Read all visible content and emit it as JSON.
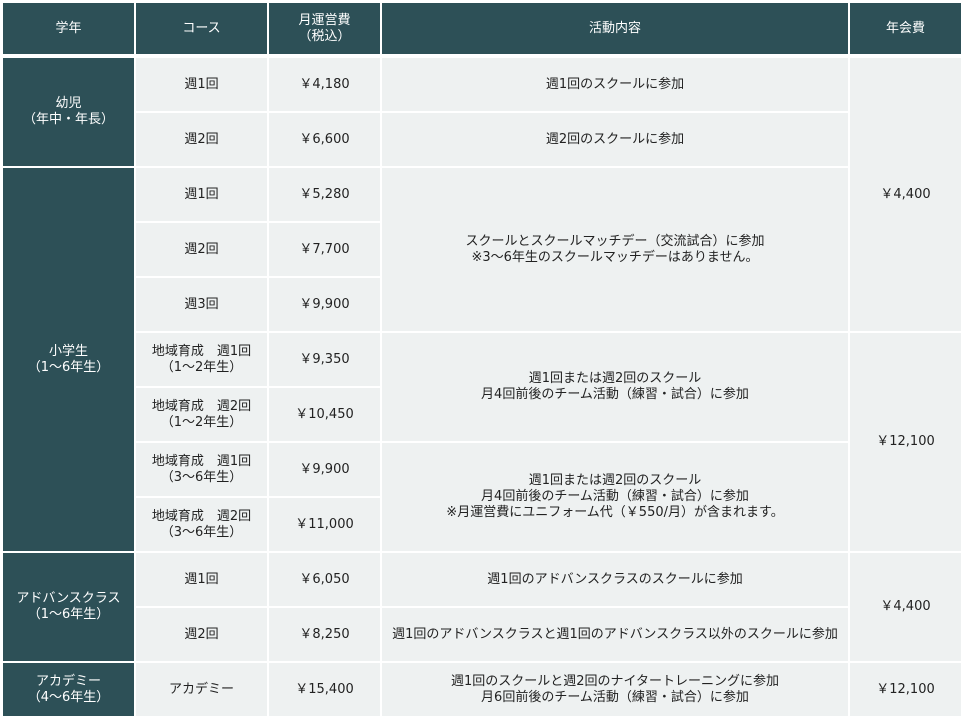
{
  "colors": {
    "header_bg": "#2d5057",
    "cell_bg": "#eef1f1",
    "header_text": "#ffffff",
    "cell_text": "#222222"
  },
  "header": {
    "grade": "学年",
    "course": "コース",
    "monthly_fee": [
      "月運営費",
      "（税込）"
    ],
    "activity": "活動内容",
    "annual_fee": "年会費"
  },
  "groups": {
    "infant": [
      "幼児",
      "（年中・年長）"
    ],
    "elementary": [
      "小学生",
      "（1～6年生）"
    ],
    "advanced": [
      "アドバンスクラス",
      "（1～6年生）"
    ],
    "academy": [
      "アカデミー",
      "（4～6年生）"
    ]
  },
  "rows": [
    {
      "course": [
        "週1回"
      ],
      "fee": "￥4,180"
    },
    {
      "course": [
        "週2回"
      ],
      "fee": "￥6,600"
    },
    {
      "course": [
        "週1回"
      ],
      "fee": "￥5,280"
    },
    {
      "course": [
        "週2回"
      ],
      "fee": "￥7,700"
    },
    {
      "course": [
        "週3回"
      ],
      "fee": "￥9,900"
    },
    {
      "course": [
        "地域育成　週1回",
        "（1～2年生）"
      ],
      "fee": "￥9,350"
    },
    {
      "course": [
        "地域育成　週2回",
        "（1～2年生）"
      ],
      "fee": "￥10,450"
    },
    {
      "course": [
        "地域育成　週1回",
        "（3～6年生）"
      ],
      "fee": "￥9,900"
    },
    {
      "course": [
        "地域育成　週2回",
        "（3～6年生）"
      ],
      "fee": "￥11,000"
    },
    {
      "course": [
        "週1回"
      ],
      "fee": "￥6,050"
    },
    {
      "course": [
        "週2回"
      ],
      "fee": "￥8,250"
    },
    {
      "course": [
        "アカデミー"
      ],
      "fee": "￥15,400"
    }
  ],
  "activities": [
    [
      "週1回のスクールに参加"
    ],
    [
      "週2回のスクールに参加"
    ],
    [
      "スクールとスクールマッチデー（交流試合）に参加",
      "※3～6年生のスクールマッチデーはありません。"
    ],
    [
      "週1回または週2回のスクール",
      "月4回前後のチーム活動（練習・試合）に参加"
    ],
    [
      "週1回または週2回のスクール",
      "月4回前後のチーム活動（練習・試合）に参加",
      "※月運営費にユニフォーム代（￥550/月）が含まれます。"
    ],
    [
      "週1回のアドバンスクラスのスクールに参加"
    ],
    [
      "週1回のアドバンスクラスと週1回のアドバンスクラス以外のスクールに参加"
    ],
    [
      "週1回のスクールと週2回のナイタートレーニングに参加",
      "月6回前後のチーム活動（練習・試合）に参加"
    ]
  ],
  "annual_fees": [
    "￥4,400",
    "￥12,100",
    "￥4,400",
    "￥12,100"
  ]
}
